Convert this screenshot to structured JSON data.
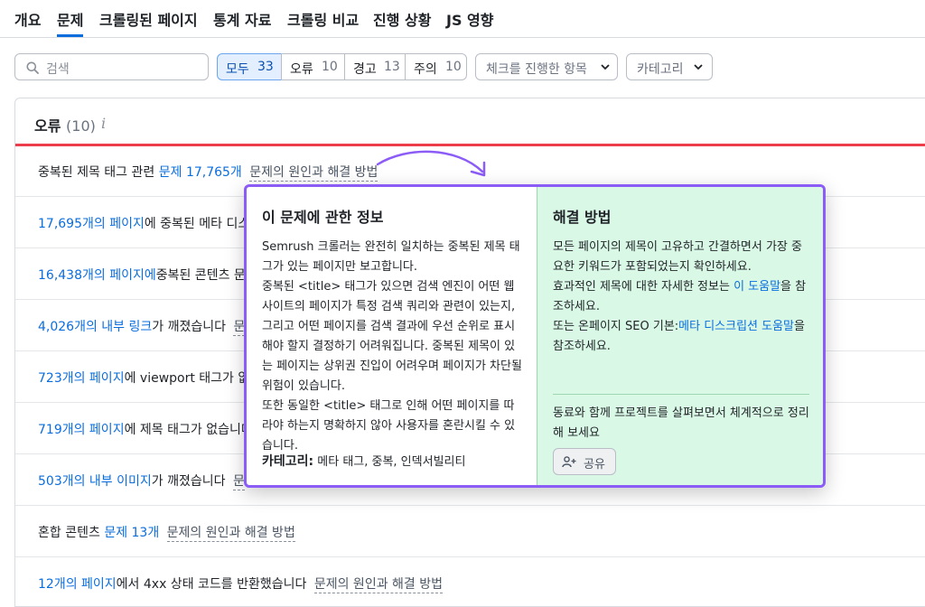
{
  "tabs": [
    {
      "label": "개요"
    },
    {
      "label": "문제"
    },
    {
      "label": "크롤링된 페이지"
    },
    {
      "label": "통계 자료"
    },
    {
      "label": "크롤링 비교"
    },
    {
      "label": "진행 상황"
    },
    {
      "label": "JS 영향"
    }
  ],
  "active_tab": "문제",
  "search": {
    "placeholder": "검색",
    "icon": "search-icon"
  },
  "filters": [
    {
      "label": "모두",
      "count": "33",
      "active": true
    },
    {
      "label": "오류",
      "count": "10",
      "active": false
    },
    {
      "label": "경고",
      "count": "13",
      "active": false
    },
    {
      "label": "주의",
      "count": "10",
      "active": false
    }
  ],
  "dropdowns": {
    "checks": {
      "label": "체크를 진행한 항목"
    },
    "category": {
      "label": "카테고리"
    }
  },
  "section": {
    "title": "오류",
    "count": "(10)",
    "info_glyph": "i"
  },
  "colors": {
    "accent": "#0a6dde",
    "error": "#ee3d4a",
    "popup_border": "#8b5cf6",
    "solution_bg": "#d9f8e6"
  },
  "rows": [
    {
      "prefix": "중복된 제목 태그 관련 ",
      "link": "문제 17,765개",
      "suffix": "",
      "cause": "문제의 원인과 해결 방법"
    },
    {
      "prefix": "",
      "link": "17,695개의 페이지",
      "suffix": "에 중복된 메타 디스",
      "cause": ""
    },
    {
      "prefix": "",
      "link": "16,438개의 페이지에",
      "suffix": "중복된 콘텐츠 문제",
      "cause": ""
    },
    {
      "prefix": "",
      "link": "4,026개의 내부 링크",
      "suffix": "가 깨졌습니다",
      "cause": "문"
    },
    {
      "prefix": "",
      "link": "723개의 페이지",
      "suffix": "에 viewport 태그가 없",
      "cause": ""
    },
    {
      "prefix": "",
      "link": "719개의 페이지",
      "suffix": "에 제목 태그가 없습니다",
      "cause": ""
    },
    {
      "prefix": "",
      "link": "503개의 내부 이미지",
      "suffix": "가 깨졌습니다",
      "cause": "문"
    },
    {
      "prefix": "혼합 콘텐츠 ",
      "link": "문제 13개",
      "suffix": "",
      "cause": "문제의 원인과 해결 방법"
    },
    {
      "prefix": "",
      "link": "12개의 페이지",
      "suffix": "에서 4xx 상태 코드를 반환했습니다",
      "cause": "문제의 원인과 해결 방법"
    }
  ],
  "popup": {
    "about_title": "이 문제에 관한 정보",
    "about_p1": "Semrush 크롤러는 완전히 일치하는 중복된 제목 태그가 있는 페이지만 보고합니다.",
    "about_p2": "중복된 <title> 태그가 있으면 검색 엔진이 어떤 웹사이트의 페이지가 특정 검색 쿼리와 관련이 있는지, 그리고 어떤 페이지를 검색 결과에 우선 순위로 표시해야 할지 결정하기 어려워집니다. 중복된 제목이 있는 페이지는 상위권 진입이 어려우며 페이지가 차단될 위험이 있습니다.",
    "about_p3": "또한 동일한 <title> 태그로 인해 어떤 페이지를 따라야 하는지 명확하지 않아 사용자를 혼란시킬 수 있습니다.",
    "category_label": "카테고리:",
    "category_value": "메타 태그, 중복, 인덱서빌리티",
    "solution_title": "해결 방법",
    "solution_p1": "모든 페이지의 제목이 고유하고 간결하면서 가장 중요한 키워드가 포함되었는지 확인하세요.",
    "solution_p2_before": "효과적인 제목에 대한 자세한 정보는 ",
    "solution_p2_link": "이 도움말",
    "solution_p2_after": "을 참조하세요.",
    "solution_p3_before": "또는 온페이지 SEO 기본:",
    "solution_p3_link": "메타 디스크립션 도움말",
    "solution_p3_after": "을 참조하세요.",
    "footer_text": "동료와 함께 프로젝트를 살펴보면서 체계적으로 정리해 보세요",
    "share_label": "공유",
    "share_icon": "add-user-icon"
  }
}
